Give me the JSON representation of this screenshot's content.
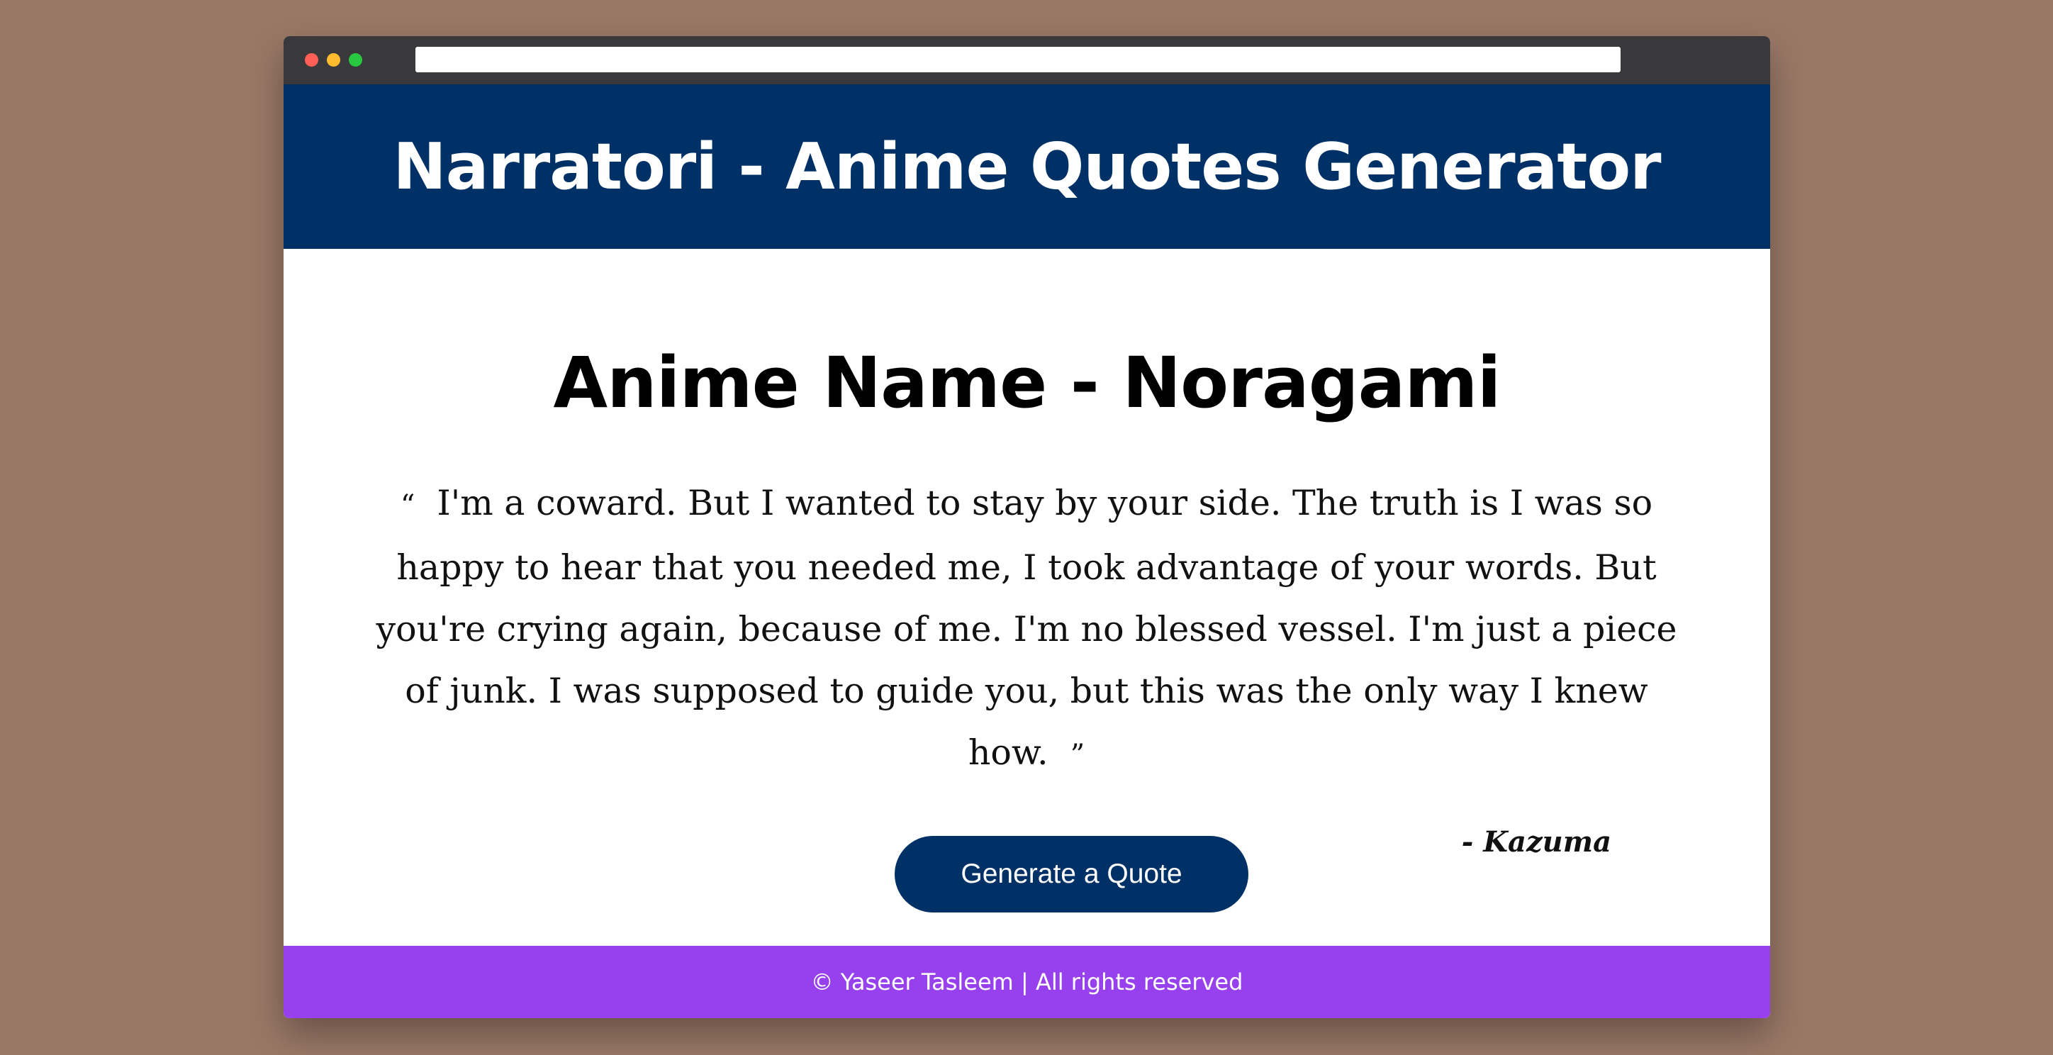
{
  "browser": {
    "controls": [
      "close",
      "minimize",
      "maximize"
    ],
    "address_bar_text": ""
  },
  "header": {
    "title": "Narratori - Anime Quotes Generator",
    "background_color": "#003166"
  },
  "main": {
    "anime_name": "Anime Name - Noragami",
    "quote_open": "“",
    "quote_text": "I'm a coward. But I wanted to stay by your side. The truth is I was so happy to hear that you needed me, I took advantage of your words. But you're crying again, because of me. I'm no blessed vessel. I'm just a piece of junk. I was supposed to guide you, but this was the only way I knew how.",
    "quote_close": "”",
    "author": "- Kazuma",
    "generate_button_label": "Generate a Quote"
  },
  "footer": {
    "copyright": "© Yaseer Tasleem | All rights reserved",
    "background_color": "#9641ed"
  }
}
